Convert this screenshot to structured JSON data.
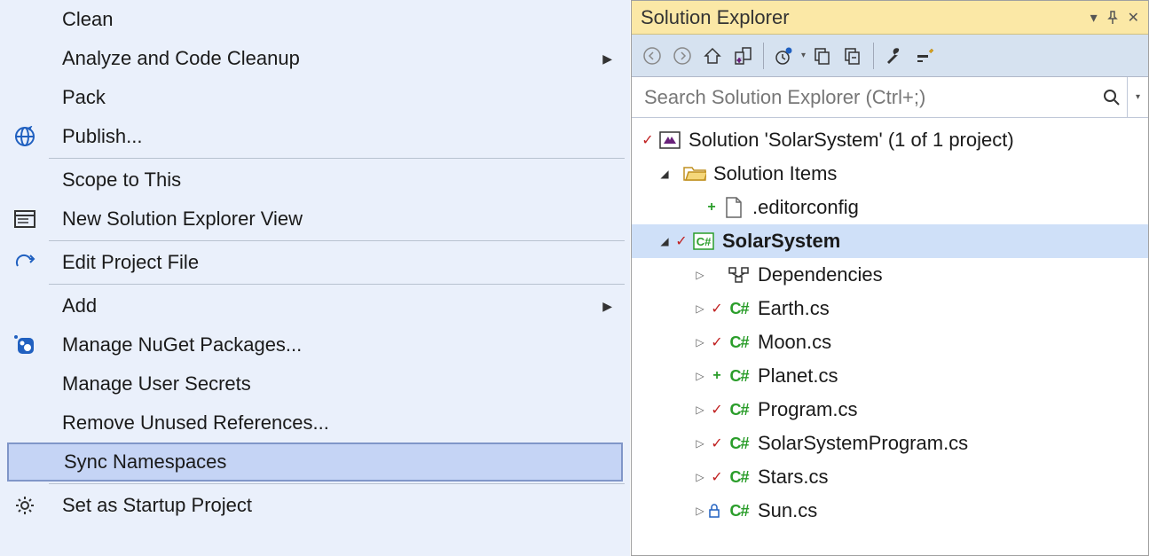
{
  "contextMenu": {
    "items": [
      {
        "label": "Clean",
        "icon": null,
        "submenu": false
      },
      {
        "label": "Analyze and Code Cleanup",
        "icon": null,
        "submenu": true
      },
      {
        "label": "Pack",
        "icon": null,
        "submenu": false
      },
      {
        "label": "Publish...",
        "icon": "globe-icon",
        "submenu": false
      },
      {
        "type": "separator"
      },
      {
        "label": "Scope to This",
        "icon": null,
        "submenu": false
      },
      {
        "label": "New Solution Explorer View",
        "icon": "explorer-icon",
        "submenu": false
      },
      {
        "type": "separator"
      },
      {
        "label": "Edit Project File",
        "icon": "redo-icon",
        "submenu": false
      },
      {
        "type": "separator"
      },
      {
        "label": "Add",
        "icon": null,
        "submenu": true
      },
      {
        "label": "Manage NuGet Packages...",
        "icon": "nuget-icon",
        "submenu": false
      },
      {
        "label": "Manage User Secrets",
        "icon": null,
        "submenu": false
      },
      {
        "label": "Remove Unused References...",
        "icon": null,
        "submenu": false
      },
      {
        "label": "Sync Namespaces",
        "icon": null,
        "submenu": false,
        "highlighted": true
      },
      {
        "type": "separator"
      },
      {
        "label": "Set as Startup Project",
        "icon": "gear-icon",
        "submenu": false
      }
    ]
  },
  "explorer": {
    "title": "Solution Explorer",
    "searchPlaceholder": "Search Solution Explorer (Ctrl+;)",
    "tree": {
      "solution": "Solution 'SolarSystem' (1 of 1 project)",
      "folder": "Solution Items",
      "editorconfig": ".editorconfig",
      "project": "SolarSystem",
      "dependencies": "Dependencies",
      "files": [
        {
          "name": "Earth.cs",
          "status": "check"
        },
        {
          "name": "Moon.cs",
          "status": "check"
        },
        {
          "name": "Planet.cs",
          "status": "plus"
        },
        {
          "name": "Program.cs",
          "status": "check"
        },
        {
          "name": "SolarSystemProgram.cs",
          "status": "check"
        },
        {
          "name": "Stars.cs",
          "status": "check"
        },
        {
          "name": "Sun.cs",
          "status": "lock"
        }
      ]
    }
  }
}
